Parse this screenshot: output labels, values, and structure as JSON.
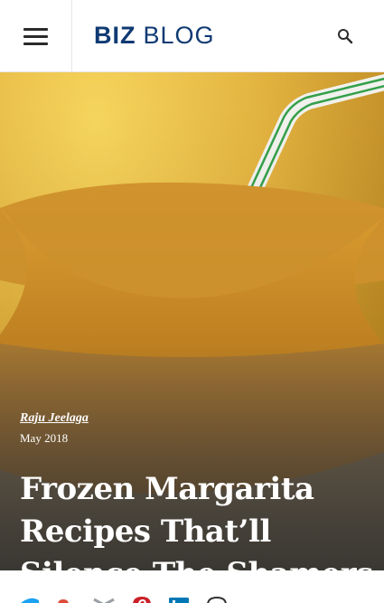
{
  "header": {
    "menu_icon": "hamburger-menu-icon",
    "logo_bold": "BIZ",
    "logo_light": "BLOG",
    "search_icon": "search-icon",
    "brand_color": "#0f3a73"
  },
  "article": {
    "author": "Raju Jeelaga",
    "date": "May 2018",
    "title": "Frozen Margarita Recipes That’ll Silence The Shamers"
  },
  "share": {
    "icons": [
      "twitter-icon",
      "google-plus-icon",
      "email-icon",
      "pinterest-icon",
      "linkedin-icon",
      "comment-icon"
    ],
    "colors": {
      "twitter": "#1da1f2",
      "google_plus": "#dd4b39",
      "email": "#9aa0a6",
      "pinterest": "#cb2027",
      "linkedin": "#0077b5",
      "comment": "#333333"
    }
  }
}
